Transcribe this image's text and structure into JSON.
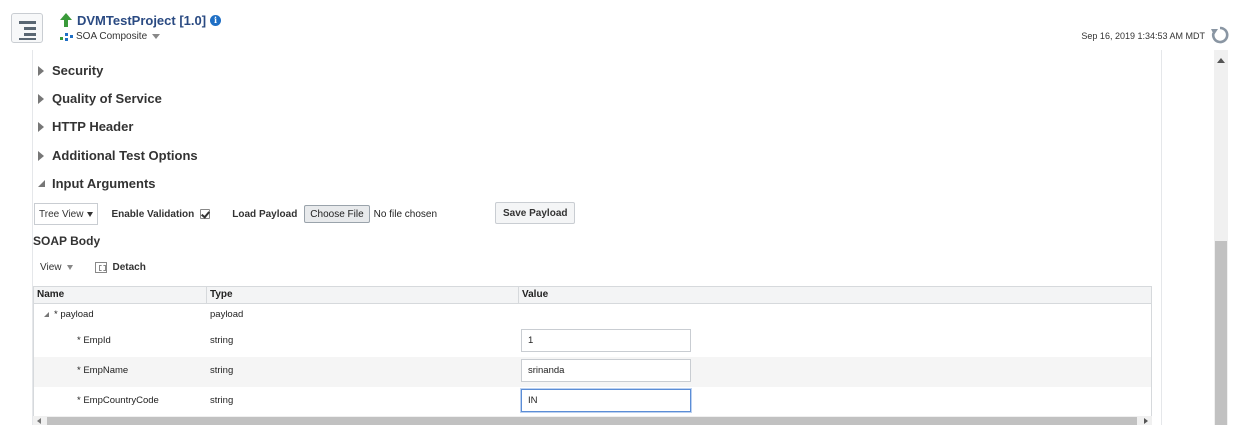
{
  "header": {
    "project_title": "DVMTestProject [1.0]",
    "info_glyph": "i",
    "composite_type": "SOA Composite",
    "timestamp": "Sep 16, 2019 1:34:53 AM MDT"
  },
  "icons": {
    "menu": "menu-icon",
    "project": "up-arrow-icon",
    "info": "info-icon",
    "composite": "composite-icon",
    "refresh": "refresh-icon",
    "detach": "detach-icon"
  },
  "sections": {
    "security": "Security",
    "qos": "Quality of Service",
    "http_header": "HTTP Header",
    "additional": "Additional Test Options",
    "input_arguments": "Input Arguments"
  },
  "toolbar": {
    "view_mode": "Tree View",
    "enable_validation": "Enable Validation",
    "load_payload": "Load Payload",
    "choose_file": "Choose File",
    "no_file": "No file chosen",
    "save_payload": "Save Payload"
  },
  "soap": {
    "title": "SOAP Body",
    "view_menu": "View",
    "detach": "Detach"
  },
  "table": {
    "headers": [
      "Name",
      "Type",
      "Value"
    ],
    "rows": [
      {
        "name": "* payload",
        "type": "payload",
        "value": null
      },
      {
        "name": "* EmpId",
        "type": "string",
        "value": "1"
      },
      {
        "name": "* EmpName",
        "type": "string",
        "value": "srinanda"
      },
      {
        "name": "* EmpCountryCode",
        "type": "string",
        "value": "IN"
      }
    ]
  },
  "colors": {
    "title_blue": "#2a4a82",
    "accent_green": "#3a9a3a",
    "info_blue": "#1f6fc5"
  }
}
